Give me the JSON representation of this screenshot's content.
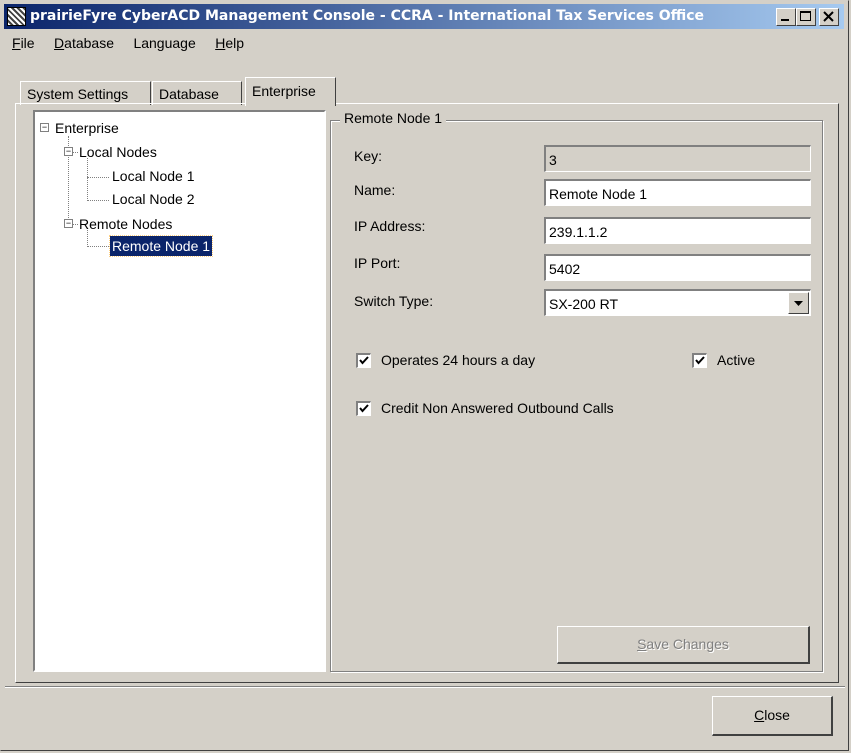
{
  "window": {
    "title": "prairieFyre CyberACD Management Console - CCRA - International Tax Services Office",
    "icon": "app-icon"
  },
  "menu": {
    "file": "ile",
    "file_hot": "F",
    "database_hot": "D",
    "database": "atabase",
    "language": "Language",
    "help_hot": "H",
    "help": "elp"
  },
  "tabs": [
    {
      "label": "System Settings",
      "active": false
    },
    {
      "label": "Database",
      "active": false
    },
    {
      "label": "Enterprise",
      "active": true
    }
  ],
  "tree": {
    "root": "Enterprise",
    "local_group": "Local Nodes",
    "local_nodes": [
      "Local Node 1",
      "Local Node 2"
    ],
    "remote_group": "Remote Nodes",
    "remote_nodes": [
      "Remote Node 1"
    ],
    "selected": "Remote Node 1"
  },
  "details": {
    "group_title": "Remote Node 1",
    "key_label": "Key:",
    "key_value": "3",
    "name_label": "Name:",
    "name_value": "Remote Node 1",
    "ip_label": "IP Address:",
    "ip_value": "239.1.1.2",
    "port_label": "IP Port:",
    "port_value": "5402",
    "switch_label": "Switch Type:",
    "switch_value": "SX-200 RT",
    "operates_label": "Operates 24 hours a day",
    "operates_checked": true,
    "active_label": "Active",
    "active_checked": true,
    "credit_label": "Credit Non Answered Outbound Calls",
    "credit_checked": true,
    "save_hot": "S",
    "save_label": "ave Changes"
  },
  "footer": {
    "close_hot": "C",
    "close_label": "lose"
  },
  "colors": {
    "titlebar_start": "#0a246a",
    "titlebar_end": "#a6caf0",
    "face": "#d4d0c8",
    "selection": "#0a246a"
  }
}
